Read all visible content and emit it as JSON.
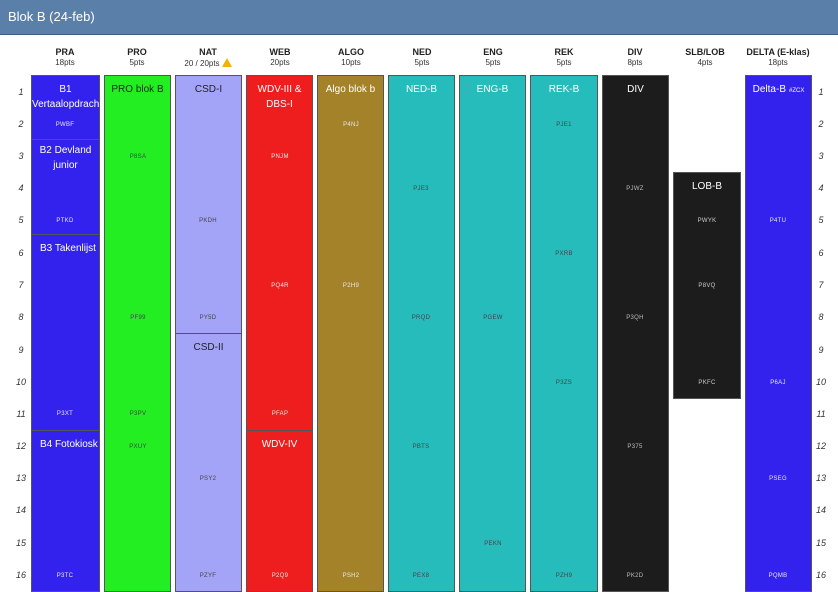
{
  "window": {
    "title": "Blok B (24-feb)"
  },
  "rows": [
    "1",
    "2",
    "3",
    "4",
    "5",
    "6",
    "7",
    "8",
    "9",
    "10",
    "11",
    "12",
    "13",
    "14",
    "15",
    "16"
  ],
  "columns": [
    {
      "name": "PRA",
      "pts": "18pts"
    },
    {
      "name": "PRO",
      "pts": "5pts"
    },
    {
      "name": "NAT",
      "pts": "20 / 20pts"
    },
    {
      "name": "WEB",
      "pts": "20pts"
    },
    {
      "name": "ALGO",
      "pts": "10pts"
    },
    {
      "name": "NED",
      "pts": "5pts"
    },
    {
      "name": "ENG",
      "pts": "5pts"
    },
    {
      "name": "REK",
      "pts": "5pts"
    },
    {
      "name": "DIV",
      "pts": "8pts"
    },
    {
      "name": "SLB/LOB",
      "pts": "4pts"
    },
    {
      "name": "DELTA (E-klas)",
      "pts": "18pts"
    }
  ],
  "colors": {
    "pra": "#3322ee",
    "pro": "#22ee22",
    "nat": "#a3a3f8",
    "web": "#ee1e1e",
    "algo": "#a4822a",
    "ned": "#26bcbc",
    "eng": "#26bcbc",
    "rek": "#26bcbc",
    "div": "#1c1c1c",
    "lob": "#1c1c1c",
    "delta": "#3322ee",
    "topbar": "#5a7fa8"
  },
  "blocks": {
    "pra1": {
      "label": "B1 Vertaalopdracht",
      "codes": [
        "PWBF",
        "PTKD"
      ]
    },
    "pra2": {
      "label": "B2 Devland junior"
    },
    "pra3": {
      "label": "B3 Takenlijst",
      "codes": [
        "P3XT"
      ]
    },
    "pra4": {
      "label": "B4 Fotokiosk",
      "codes": [
        "P3TC"
      ]
    },
    "pro": {
      "label": "PRO blok B",
      "codes": [
        "P8SA",
        "PF99",
        "P3PV",
        "PXUY"
      ]
    },
    "nat1": {
      "label": "CSD-I",
      "codes": [
        "PKDH",
        "PY5D"
      ]
    },
    "nat2": {
      "label": "CSD-II",
      "codes": [
        "PSY2",
        "PZYF"
      ]
    },
    "web1": {
      "label": "WDV-III & DBS-I",
      "codes": [
        "PNJM",
        "PQ4R",
        "PFAP"
      ]
    },
    "web2": {
      "label": "WDV-IV",
      "codes": [
        "P2Q9"
      ]
    },
    "algo": {
      "label": "Algo blok b",
      "codes": [
        "P4NJ",
        "P2H9",
        "PSH2"
      ]
    },
    "ned": {
      "label": "NED-B",
      "codes": [
        "PJE3",
        "PRQD",
        "PBTS",
        "PEX8"
      ]
    },
    "eng": {
      "label": "ENG-B",
      "codes": [
        "PGEW",
        "PEKN"
      ]
    },
    "rek": {
      "label": "REK-B",
      "codes": [
        "PJE1",
        "PXRB",
        "P3ZS",
        "PZH9"
      ]
    },
    "div": {
      "label": "DIV",
      "codes": [
        "PJWZ",
        "P3QH",
        "P375",
        "PK2D"
      ]
    },
    "lob": {
      "label": "LOB-B",
      "codes": [
        "PWYK",
        "P8VQ",
        "PKFC"
      ]
    },
    "delta": {
      "label": "Delta-B",
      "badge": "#ZCX",
      "codes": [
        "P4TU",
        "P6AJ",
        "PSEG",
        "PQMB"
      ]
    }
  }
}
